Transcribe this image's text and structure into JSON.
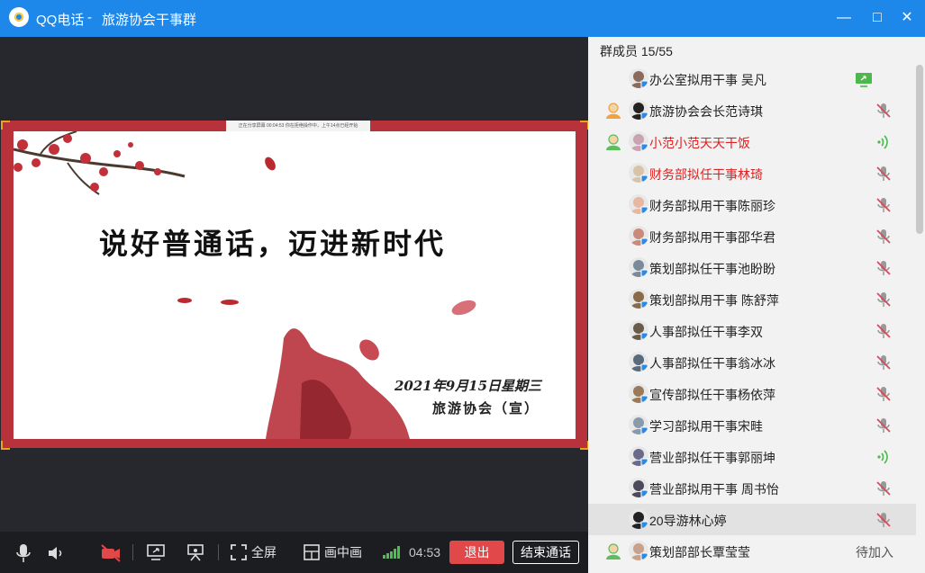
{
  "window": {
    "app_name": "QQ电话",
    "separator": "-",
    "group_name": "旅游协会干事群",
    "minimize_label": "—",
    "maximize_label": "□",
    "close_label": "✕"
  },
  "slide": {
    "notice": "正在分享屏幕  00:04:53  你在拒绝操作中，上午14点已经开始",
    "slogan": "说好普通话，迈进新时代",
    "date_line": "2021年9月15日星期三",
    "seal_line": "旅游协会（宣）"
  },
  "toolbar": {
    "fullscreen_label": "全屏",
    "pip_label": "画中画",
    "call_time": "04:53",
    "exit_label": "退出",
    "end_call_label": "结束通话"
  },
  "members": {
    "header": "群成员 15/55",
    "list": [
      {
        "name": "办公室拟用干事 吴凡",
        "red": false,
        "role": "",
        "status": "screen-share",
        "avatar": "#8a6a5a"
      },
      {
        "name": "旅游协会会长范诗琪",
        "red": false,
        "role": "admin-orange",
        "status": "mic-muted",
        "avatar": "#222222"
      },
      {
        "name": "小范小范天天干饭",
        "red": true,
        "role": "admin-green",
        "status": "speaking",
        "avatar": "#c9a3b0"
      },
      {
        "name": "财务部拟任干事林琦",
        "red": true,
        "role": "",
        "status": "mic-muted",
        "avatar": "#d9c3a8"
      },
      {
        "name": "财务部拟用干事陈丽珍",
        "red": false,
        "role": "",
        "status": "mic-muted",
        "avatar": "#e7b7a0"
      },
      {
        "name": "财务部拟用干事邵华君",
        "red": false,
        "role": "",
        "status": "mic-muted",
        "avatar": "#c98a7a"
      },
      {
        "name": "策划部拟任干事池盼盼",
        "red": false,
        "role": "",
        "status": "mic-muted",
        "avatar": "#7a8a9a"
      },
      {
        "name": "策划部拟用干事 陈舒萍",
        "red": false,
        "role": "",
        "status": "mic-muted",
        "avatar": "#8a6a4a"
      },
      {
        "name": "人事部拟任干事李双",
        "red": false,
        "role": "",
        "status": "mic-muted",
        "avatar": "#6a5a4a"
      },
      {
        "name": "人事部拟任干事翁冰冰",
        "red": false,
        "role": "",
        "status": "mic-muted",
        "avatar": "#5a6a7a"
      },
      {
        "name": "宣传部拟任干事杨依萍",
        "red": false,
        "role": "",
        "status": "mic-muted",
        "avatar": "#9a7a5a"
      },
      {
        "name": "学习部拟用干事宋畦",
        "red": false,
        "role": "",
        "status": "mic-muted",
        "avatar": "#8a9aaa"
      },
      {
        "name": "营业部拟任干事郭丽坤",
        "red": false,
        "role": "",
        "status": "speaking",
        "avatar": "#6a6a8a"
      },
      {
        "name": "营业部拟用干事 周书怡",
        "red": false,
        "role": "",
        "status": "mic-muted",
        "avatar": "#4a4a5a"
      },
      {
        "name": "20导游林心婷",
        "red": false,
        "role": "",
        "status": "mic-muted",
        "avatar": "#222222"
      },
      {
        "name": "策划部部长覃莹莹",
        "red": false,
        "role": "admin-green",
        "status": "pending",
        "avatar": "#c9a08a",
        "pending_label": "待加入"
      }
    ]
  },
  "colors": {
    "title_bar": "#1e87ea",
    "exit_button": "#e0484a",
    "slide_border": "#b8323c",
    "speaking": "#4cb84c",
    "muted": "#d84a5a"
  }
}
